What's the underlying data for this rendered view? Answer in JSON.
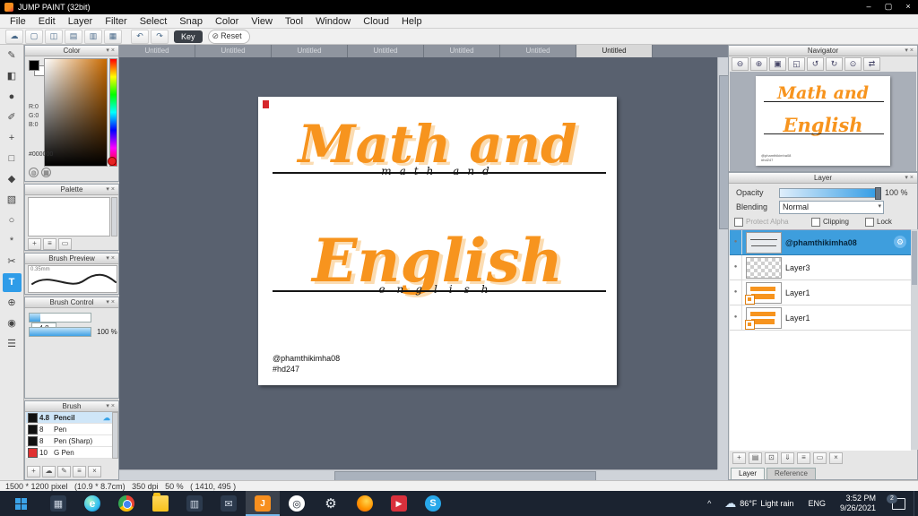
{
  "window": {
    "title": "JUMP PAINT (32bit)",
    "minimize_glyph": "–",
    "maximize_glyph": "▢",
    "close_glyph": "×"
  },
  "ui": {
    "collapse_glyph": "▾",
    "close_glyph": "×"
  },
  "menu": {
    "items": [
      "File",
      "Edit",
      "Layer",
      "Filter",
      "Select",
      "Snap",
      "Color",
      "View",
      "Tool",
      "Window",
      "Cloud",
      "Help"
    ]
  },
  "toolbar": {
    "buttons": [
      {
        "name": "cloud-icon",
        "glyph": "☁"
      },
      {
        "name": "new-canvas-icon",
        "glyph": "▢"
      },
      {
        "name": "save-icon",
        "glyph": "◫"
      },
      {
        "name": "layout-1-icon",
        "glyph": "▤"
      },
      {
        "name": "layout-2-icon",
        "glyph": "▥"
      },
      {
        "name": "layout-3-icon",
        "glyph": "▦"
      }
    ],
    "undo_glyph": "↶",
    "redo_glyph": "↷",
    "key_label": "Key",
    "reset_label": "Reset",
    "reset_glyph": "⊘"
  },
  "tabs": [
    {
      "label": "Untitled"
    },
    {
      "label": "Untitled"
    },
    {
      "label": "Untitled"
    },
    {
      "label": "Untitled"
    },
    {
      "label": "Untitled"
    },
    {
      "label": "Untitled"
    },
    {
      "label": "Untitled"
    }
  ],
  "tools": [
    {
      "name": "brush-tool",
      "glyph": "✎"
    },
    {
      "name": "eraser-tool",
      "glyph": "◧"
    },
    {
      "name": "finger-tool",
      "glyph": "●"
    },
    {
      "name": "pen-tool",
      "glyph": "✐"
    },
    {
      "name": "move-tool",
      "glyph": "+"
    },
    {
      "name": "rect-select-tool",
      "glyph": "□"
    },
    {
      "name": "fill-tool",
      "glyph": "◆"
    },
    {
      "name": "gradient-tool",
      "glyph": "▧"
    },
    {
      "name": "lasso-tool",
      "glyph": "○"
    },
    {
      "name": "magic-wand-tool",
      "glyph": "*"
    },
    {
      "name": "select-pen-tool",
      "glyph": "✂"
    },
    {
      "name": "text-tool",
      "glyph": "T"
    },
    {
      "name": "zoom-tool",
      "glyph": "⊕"
    },
    {
      "name": "eyedropper-tool",
      "glyph": "◉"
    },
    {
      "name": "hand-tool",
      "glyph": "☰"
    }
  ],
  "color_panel": {
    "title": "Color",
    "r": "R:0",
    "g": "G:0",
    "b": "B:0",
    "hex": "#000000",
    "wheel_glyph": "◍",
    "grid_glyph": "▦"
  },
  "palette_panel": {
    "title": "Palette",
    "buttons": [
      {
        "name": "add-color-icon",
        "glyph": "+"
      },
      {
        "name": "palette-menu-icon",
        "glyph": "≡"
      },
      {
        "name": "delete-color-icon",
        "glyph": "▭"
      }
    ]
  },
  "brush_preview_panel": {
    "title": "Brush Preview",
    "size_label": "0.35mm"
  },
  "brush_control_panel": {
    "title": "Brush Control",
    "size_value": "4.8",
    "opacity_value": "100 %"
  },
  "brush_panel": {
    "title": "Brush",
    "cloud_glyph": "☁",
    "items": [
      {
        "size": "4.8",
        "name": "Pencil",
        "chip": "#111111"
      },
      {
        "size": "8",
        "name": "Pen",
        "chip": "#111111"
      },
      {
        "size": "8",
        "name": "Pen (Sharp)",
        "chip": "#111111"
      },
      {
        "size": "10",
        "name": "G Pen",
        "chip": "#e03131"
      }
    ],
    "footer": [
      {
        "name": "add-brush-icon",
        "glyph": "+"
      },
      {
        "name": "cloud-brush-icon",
        "glyph": "☁"
      },
      {
        "name": "edit-brush-icon",
        "glyph": "✎"
      },
      {
        "name": "brush-menu-icon",
        "glyph": "≡"
      },
      {
        "name": "delete-brush-icon",
        "glyph": "×"
      }
    ]
  },
  "canvas": {
    "word1": "Math and",
    "word2": "English",
    "script1": "math and",
    "script2": "english",
    "credit_line1": "@phamthikimha08",
    "credit_line2": "#hd247",
    "accent_color": "#F7941E",
    "shadow_color": "#FBDCB2"
  },
  "navigator": {
    "title": "Navigator",
    "buttons": [
      {
        "name": "zoom-out-icon",
        "glyph": "⊖"
      },
      {
        "name": "zoom-in-icon",
        "glyph": "⊕"
      },
      {
        "name": "zoom-fit-icon",
        "glyph": "▣"
      },
      {
        "name": "zoom-actual-icon",
        "glyph": "◱"
      },
      {
        "name": "rotate-left-icon",
        "glyph": "↺"
      },
      {
        "name": "rotate-right-icon",
        "glyph": "↻"
      },
      {
        "name": "reset-rotation-icon",
        "glyph": "⊙"
      },
      {
        "name": "flip-view-icon",
        "glyph": "⇄"
      }
    ]
  },
  "layer_panel": {
    "title": "Layer",
    "opacity_label": "Opacity",
    "opacity_value": "100 %",
    "blending_label": "Blending",
    "blending_value": "Normal",
    "protect_alpha_label": "Protect Alpha",
    "clipping_label": "Clipping",
    "lock_label": "Lock",
    "gear_glyph": "⚙",
    "layers": [
      {
        "name": "@phamthikimha08"
      },
      {
        "name": "Layer3"
      },
      {
        "name": "Layer1"
      },
      {
        "name": "Layer1"
      }
    ],
    "footer": [
      {
        "name": "add-layer-icon",
        "glyph": "+"
      },
      {
        "name": "add-folder-icon",
        "glyph": "▤"
      },
      {
        "name": "duplicate-layer-icon",
        "glyph": "⊡"
      },
      {
        "name": "merge-down-icon",
        "glyph": "⇓"
      },
      {
        "name": "layer-menu-icon",
        "glyph": "≡"
      },
      {
        "name": "transfer-icon",
        "glyph": "▭"
      },
      {
        "name": "delete-layer-icon",
        "glyph": "×"
      }
    ],
    "tabs": [
      "Layer",
      "Reference"
    ]
  },
  "statusbar": {
    "text": "1500 * 1200 pixel   (10.9 * 8.7cm)   350 dpi   50 %   ( 1410, 495 )"
  },
  "taskbar": {
    "icons": [
      {
        "name": "task-view-icon",
        "glyph": "▦"
      },
      {
        "name": "edge-icon",
        "glyph": "e"
      },
      {
        "name": "chrome-icon",
        "glyph": ""
      },
      {
        "name": "file-explorer-icon",
        "glyph": ""
      },
      {
        "name": "store-icon",
        "glyph": "▥"
      },
      {
        "name": "mail-icon",
        "glyph": "✉"
      },
      {
        "name": "jump-paint-icon",
        "glyph": "J"
      },
      {
        "name": "obs-icon",
        "glyph": "◎"
      },
      {
        "name": "settings-icon",
        "glyph": "⚙"
      },
      {
        "name": "firefox-icon",
        "glyph": ""
      },
      {
        "name": "media-icon",
        "glyph": "▶"
      },
      {
        "name": "skype-icon",
        "glyph": "S"
      }
    ],
    "tray_caret": "^",
    "weather_icon": "☁",
    "weather_temp": "86°F",
    "weather_cond": "Light rain",
    "lang": "ENG",
    "time": "3:52 PM",
    "date": "9/26/2021",
    "badge": "2"
  }
}
